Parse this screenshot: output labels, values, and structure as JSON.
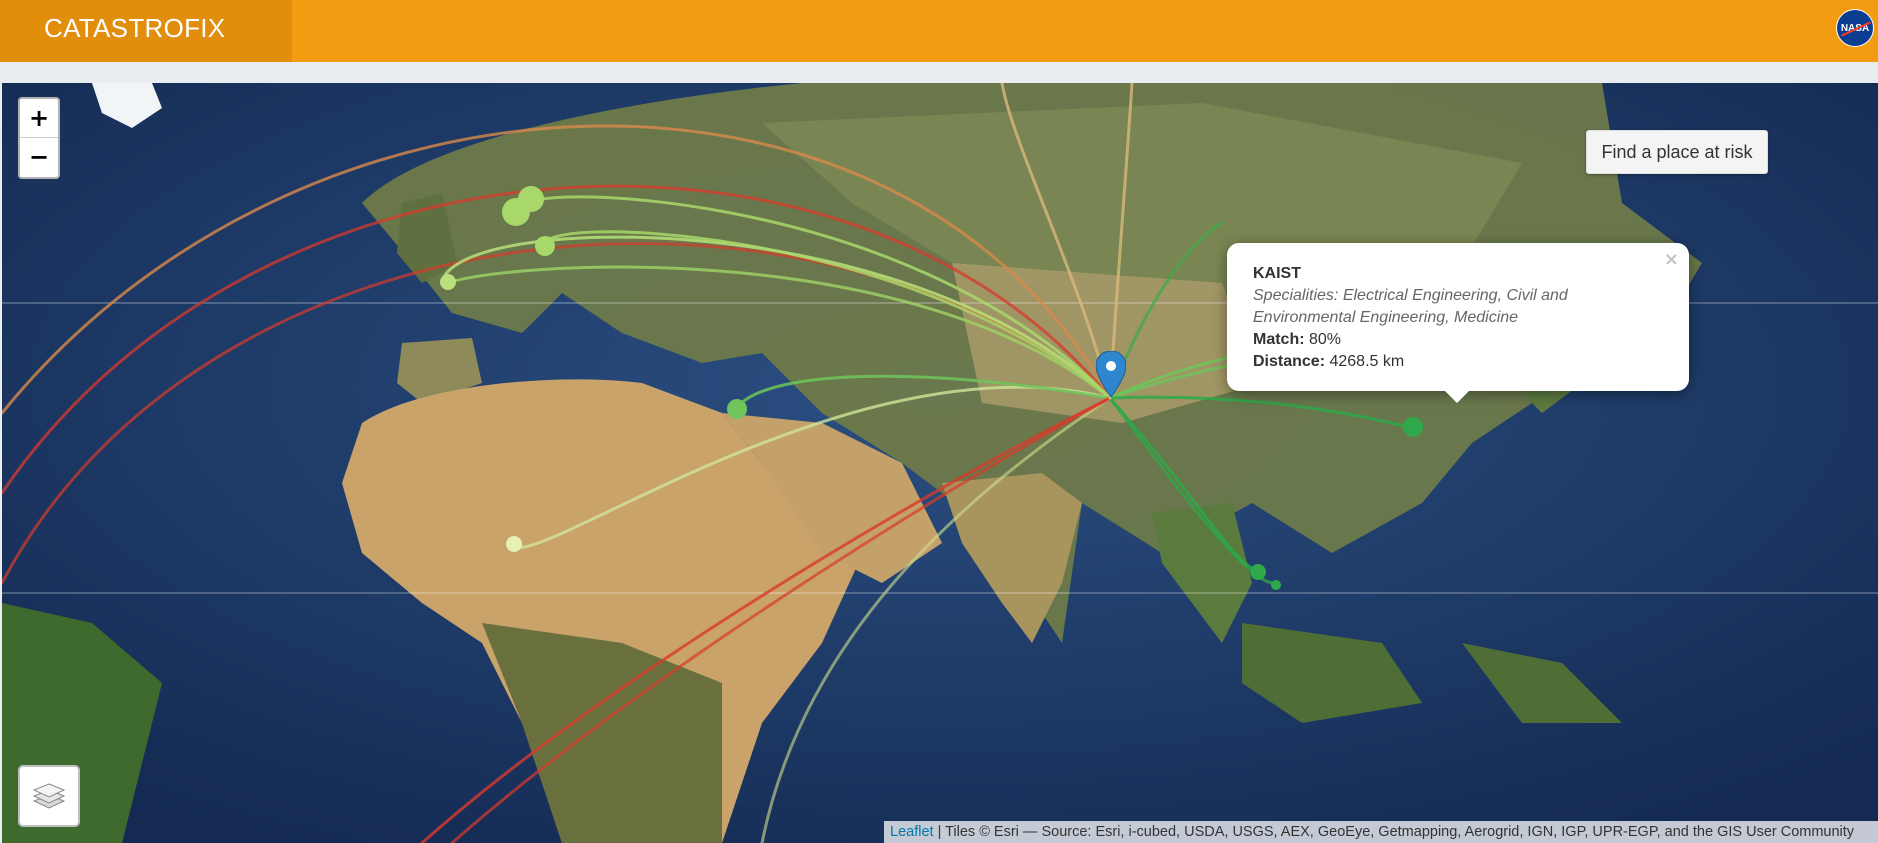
{
  "app": {
    "brand": "CATASTROFIX",
    "logo_icon": "nasa-logo",
    "logo_text": "NASA",
    "accent_color": "#f39c12"
  },
  "map": {
    "zoom_in_label": "+",
    "zoom_out_label": "−",
    "find_button_label": "Find a place at risk",
    "layers_icon": "layers-icon",
    "marker_icon": "map-pin-icon",
    "attribution_link": "Leaflet",
    "attribution_text": " | Tiles © Esri — Source: Esri, i-cubed, USDA, USGS, AEX, GeoEye, Getmapping, Aerogrid, IGN, IGP, UPR-EGP, and the GIS User Community",
    "line_colors": {
      "red": "#d93a2b",
      "orange": "#d88a4a",
      "light_green": "#a8d86a",
      "dark_green": "#2ea84a",
      "tan": "#d9b87a"
    }
  },
  "popup": {
    "close": "×",
    "title": "KAIST",
    "specialities": "Specialities: Electrical Engineering, Civil and Environmental Engineering, Medicine",
    "match_label": "Match:",
    "match_value": " 80%",
    "distance_label": "Distance:",
    "distance_value": " 4268.5 km"
  }
}
